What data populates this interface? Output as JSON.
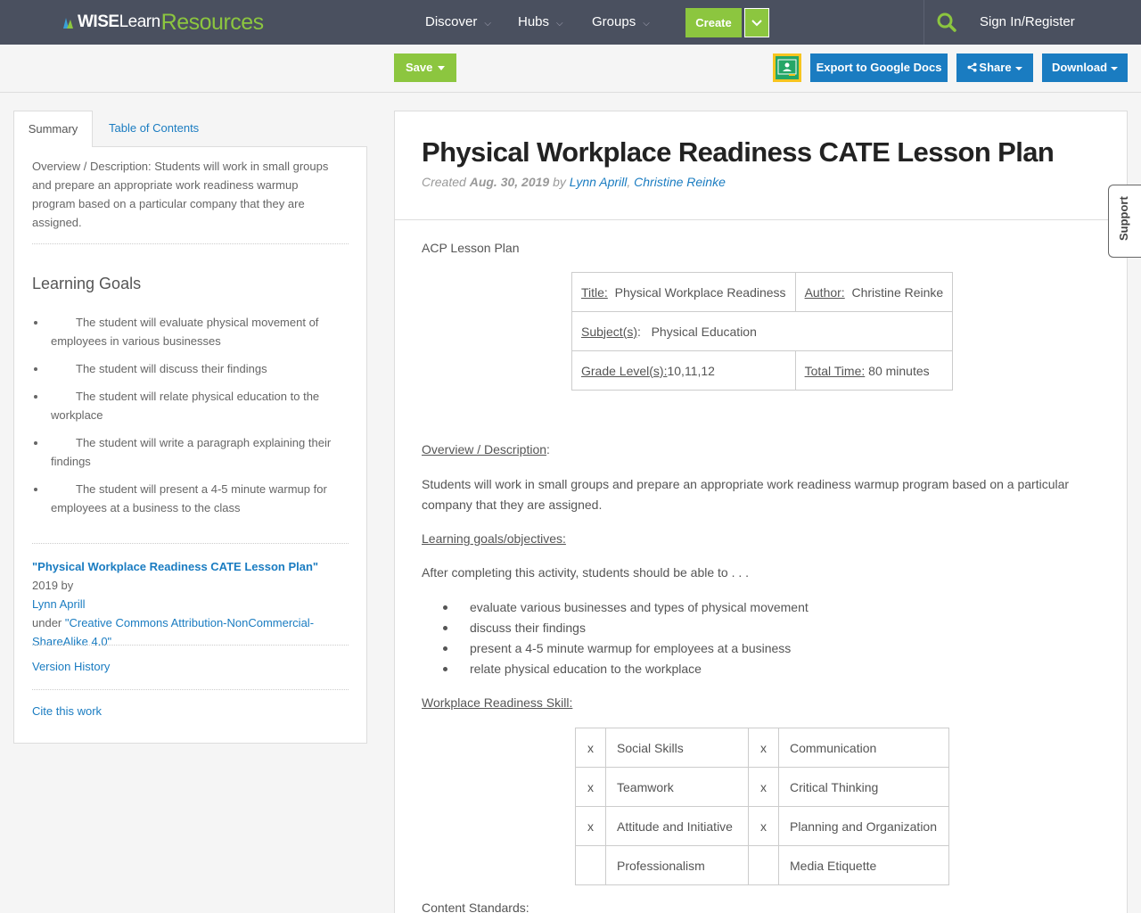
{
  "nav": {
    "logo_wise": "WISE",
    "logo_learn": "Learn",
    "logo_resources": "Resources",
    "items": [
      "Discover",
      "Hubs",
      "Groups"
    ],
    "create_label": "Create",
    "signin_label": "Sign In/Register"
  },
  "toolbar": {
    "save_label": "Save",
    "export_label": "Export to Google Docs",
    "share_label": "Share",
    "download_label": "Download"
  },
  "sidebar": {
    "tabs": [
      "Summary",
      "Table of Contents"
    ],
    "description": "Overview / Description: Students will work in small groups and prepare an appropriate work readiness warmup program based on a particular company that they are assigned.",
    "goals_heading": "Learning Goals",
    "goals": [
      "The student will evaluate physical movement of employees in various businesses",
      "The student will discuss their findings",
      "The student will relate physical education to the workplace",
      "The student will write a paragraph explaining their findings",
      "The student will present a 4-5 minute warmup for employees at a business to the class"
    ],
    "attribution": {
      "work_title": "\"Physical Workplace Readiness CATE Lesson Plan\"",
      "year_by": " 2019 by ",
      "author": "Lynn Aprill",
      "under": "under ",
      "license": "\"Creative Commons Attribution-NonCommercial-ShareAlike 4.0\""
    },
    "version_history": "Version History",
    "cite": "Cite this work"
  },
  "main": {
    "title": "Physical Workplace Readiness CATE Lesson Plan",
    "meta_created": "Created ",
    "meta_date": "Aug. 30, 2019",
    "meta_by": " by ",
    "author1": "Lynn Aprill",
    "author_sep": ", ",
    "author2": "Christine Reinke",
    "acp": "ACP Lesson Plan",
    "info_table": {
      "title_label": "Title:",
      "title_value": "Physical Workplace Readiness",
      "author_label": "Author:",
      "author_value": "Christine Reinke",
      "subject_label": "Subject(s)",
      "subject_value": "Physical Education",
      "grade_label": "Grade Level(s):",
      "grade_value": "10,11,12",
      "time_label": "Total Time:",
      "time_value": "80 minutes"
    },
    "overview_heading": "Overview / Description",
    "overview_text": "Students will work in small groups and prepare an appropriate work readiness warmup program based on a particular company that they are assigned.",
    "goals_heading": "Learning goals/objectives:",
    "goals_intro": "After completing this activity, students should be able to . . .",
    "objectives": [
      "evaluate various businesses and types of physical movement",
      "discuss their findings",
      "present a 4-5 minute warmup for employees at a business",
      "relate physical education to the workplace"
    ],
    "skills_heading": "Workplace Readiness Skill:",
    "skills": [
      {
        "m1": "x",
        "s1": "Social Skills",
        "m2": "x",
        "s2": "Communication"
      },
      {
        "m1": "x",
        "s1": "Teamwork",
        "m2": "x",
        "s2": "Critical Thinking"
      },
      {
        "m1": "x",
        "s1": "Attitude and Initiative",
        "m2": "x",
        "s2": "Planning and Organization"
      },
      {
        "m1": "",
        "s1": "Professionalism",
        "m2": "",
        "s2": "Media Etiquette"
      }
    ],
    "standards_heading": "Content Standards:"
  },
  "support_label": "Support",
  "colors": {
    "nav_bg": "#4a505f",
    "accent_green": "#8cc63f",
    "accent_blue": "#1a7cc1"
  }
}
